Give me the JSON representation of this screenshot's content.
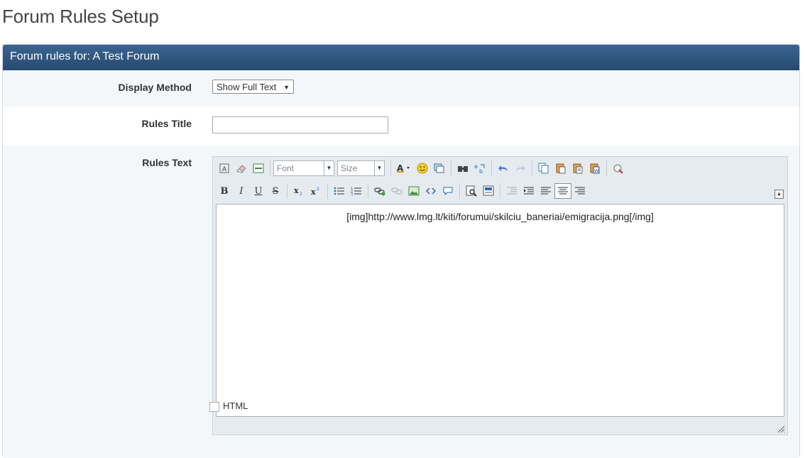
{
  "page": {
    "title": "Forum Rules Setup"
  },
  "panel": {
    "header": "Forum rules for: A Test Forum"
  },
  "form": {
    "display_method": {
      "label": "Display Method",
      "value": "Show Full Text"
    },
    "rules_title": {
      "label": "Rules Title",
      "value": ""
    },
    "rules_text": {
      "label": "Rules Text",
      "content": "[img]http://www.lmg.lt/kiti/forumui/skilciu_baneriai/emigracija.png[/img]"
    },
    "html_checkbox_label": "HTML"
  },
  "editor_toolbar": {
    "font_combo": "Font",
    "size_combo": "Size"
  }
}
